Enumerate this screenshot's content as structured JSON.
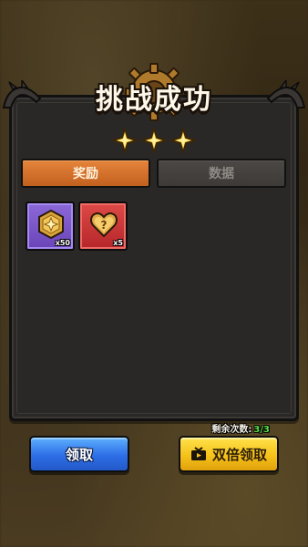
{
  "title": "挑战成功",
  "stars_earned": 3,
  "tabs": [
    {
      "label": "奖励",
      "active": true
    },
    {
      "label": "数据",
      "active": false
    }
  ],
  "rewards": [
    {
      "icon": "star-badge-icon",
      "count": "x50",
      "rarity_color": "#7a55c8"
    },
    {
      "icon": "mystery-heart-icon",
      "count": "x5",
      "rarity_color": "#c83234"
    }
  ],
  "remaining": {
    "label": "剩余次数:",
    "value": "3/3"
  },
  "buttons": {
    "claim": "领取",
    "double_claim": "双倍领取"
  },
  "colors": {
    "tab_active": "#d8722e",
    "button_blue": "#2d6ee6",
    "button_yellow": "#f5c21a",
    "remaining_value": "#5ce04a"
  }
}
